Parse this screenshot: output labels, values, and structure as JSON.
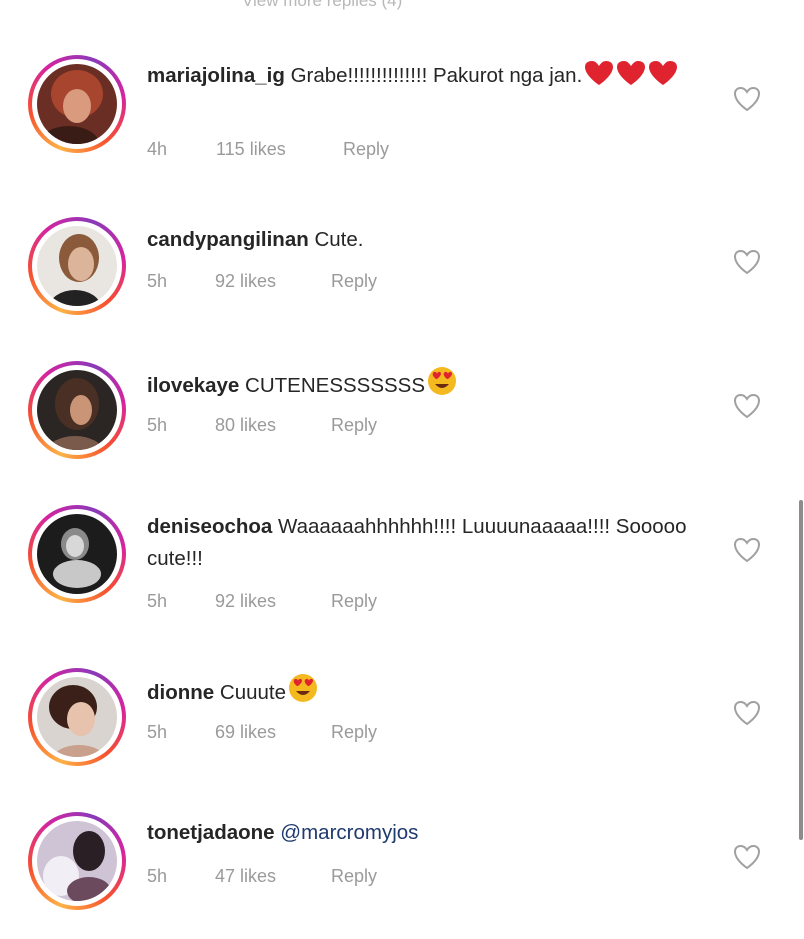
{
  "header": {
    "view_more": "View more replies (4)"
  },
  "comments": [
    {
      "username": "mariajolina_ig",
      "text": "Grabe!!!!!!!!!!!!!! Pakurot nga jan.",
      "time": "4h",
      "likes": "115 likes",
      "reply": "Reply"
    },
    {
      "username": "candypangilinan",
      "text": "Cute.",
      "time": "5h",
      "likes": "92 likes",
      "reply": "Reply"
    },
    {
      "username": "ilovekaye",
      "text": "CUTENESSSSSSS",
      "time": "5h",
      "likes": "80 likes",
      "reply": "Reply"
    },
    {
      "username": "deniseochoa",
      "text": "Waaaaaahhhhhh!!!! Luuuunaaaaa!!!! Sooooo cute!!!",
      "time": "5h",
      "likes": "92 likes",
      "reply": "Reply"
    },
    {
      "username": "dionne",
      "text": "Cuuute",
      "time": "5h",
      "likes": "69 likes",
      "reply": "Reply"
    },
    {
      "username": "tonetjadaone",
      "text": "@marcromyjos",
      "time": "5h",
      "likes": "47 likes",
      "reply": "Reply"
    }
  ],
  "icons": {
    "like": "heart-outline-icon",
    "red_heart": "red-heart-emoji",
    "heart_eyes": "heart-eyes-emoji"
  },
  "colors": {
    "mention": "#1e3a6e",
    "meta": "#9a9a9a",
    "ring_start": "#fdb347",
    "ring_end": "#8a3ab9"
  }
}
